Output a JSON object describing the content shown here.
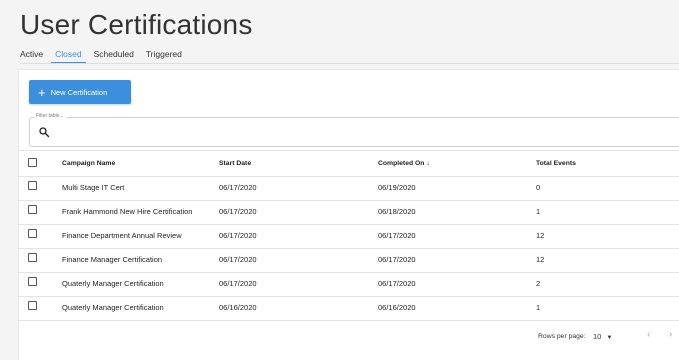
{
  "page": {
    "title": "User Certifications"
  },
  "tabs": [
    {
      "label": "Active"
    },
    {
      "label": "Closed"
    },
    {
      "label": "Scheduled"
    },
    {
      "label": "Triggered"
    }
  ],
  "active_tab": "Closed",
  "toolbar": {
    "new_label": "New Certification"
  },
  "filter": {
    "label": "Filter table...",
    "value": ""
  },
  "table": {
    "columns": [
      "Campaign Name",
      "Start Date",
      "Completed On",
      "Total Events"
    ],
    "sort_indicator": "↓",
    "rows": [
      {
        "name": "Multi Stage IT Cert",
        "start": "06/17/2020",
        "completed": "06/19/2020",
        "events": "0"
      },
      {
        "name": "Frank Hammond New Hire Certification",
        "start": "06/17/2020",
        "completed": "06/18/2020",
        "events": "1"
      },
      {
        "name": "Finance Department Annual Review",
        "start": "06/17/2020",
        "completed": "06/17/2020",
        "events": "12"
      },
      {
        "name": "Finance Manager Certification",
        "start": "06/17/2020",
        "completed": "06/17/2020",
        "events": "12"
      },
      {
        "name": "Quaterly Manager Certification",
        "start": "06/17/2020",
        "completed": "06/17/2020",
        "events": "2"
      },
      {
        "name": "Quaterly Manager Certification",
        "start": "06/16/2020",
        "completed": "06/16/2020",
        "events": "1"
      }
    ]
  },
  "pagination": {
    "rows_label": "Rows per page:",
    "rows_value": "10"
  },
  "colors": {
    "accent": "#3b8fdc"
  }
}
